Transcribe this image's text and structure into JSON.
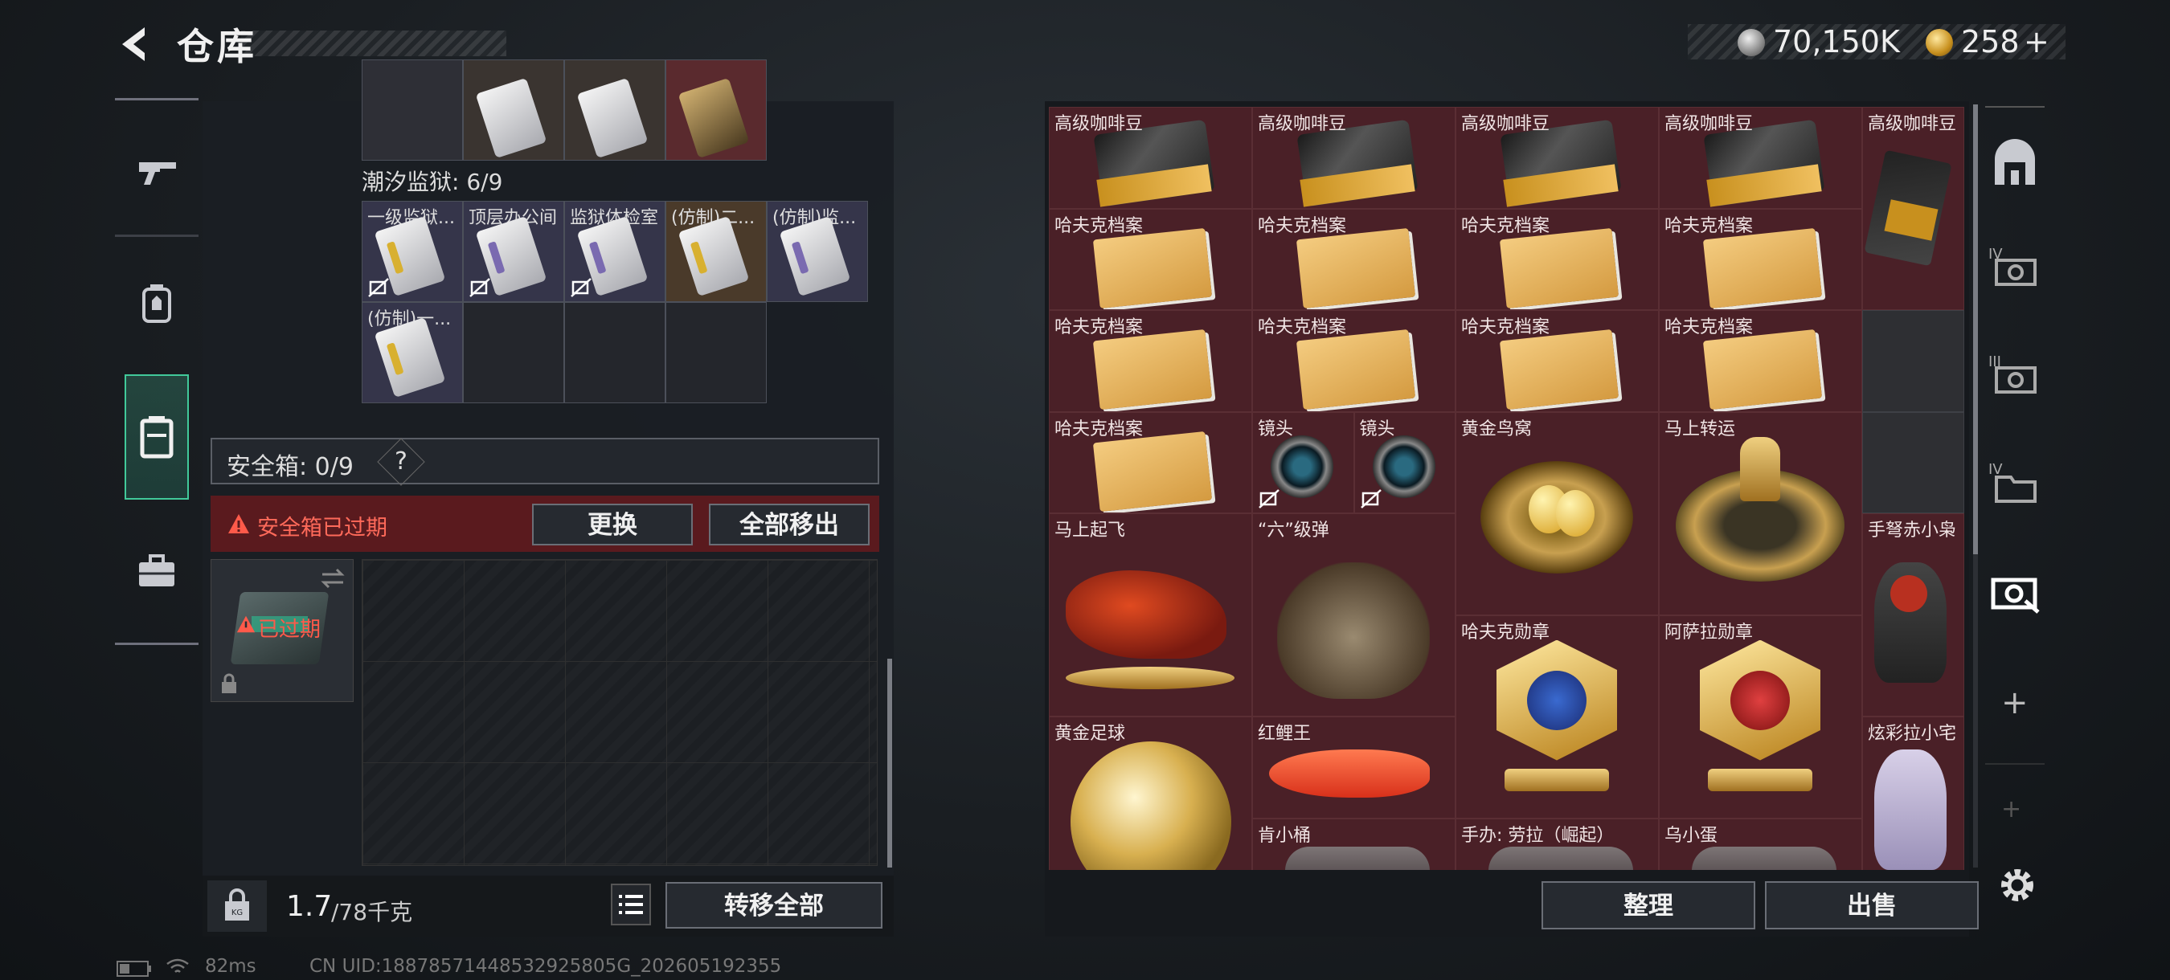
{
  "header": {
    "title": "仓库",
    "silver": "70,150K",
    "gold": "258",
    "gold_plus": "+"
  },
  "left_nav": [
    "gun-icon",
    "backpack-icon",
    "container-icon",
    "briefcase-icon"
  ],
  "prison": {
    "label": "潮汐监狱: 6/9",
    "top_row_colors": [
      "#2e2f36",
      "#3a3430",
      "#3a3430",
      "#5a2a2e"
    ],
    "cells": [
      {
        "label": "一级监狱...",
        "stripe": "#d8b030",
        "bg": "#35354a",
        "nontrade": true
      },
      {
        "label": "顶层办公间",
        "stripe": "#7a6ab0",
        "bg": "#35354a",
        "nontrade": true
      },
      {
        "label": "监狱体检室",
        "stripe": "#7a6ab0",
        "bg": "#35354a",
        "nontrade": true
      },
      {
        "label": "(仿制)二...",
        "stripe": "#d8b030",
        "bg": "#4a3a2a",
        "nontrade": false
      },
      {
        "label": "(仿制)监...",
        "stripe": "#7a6ab0",
        "bg": "#35354a",
        "nontrade": false
      },
      {
        "label": "(仿制)一...",
        "stripe": "#d8b030",
        "bg": "#35354a",
        "nontrade": false
      }
    ]
  },
  "safe_box": {
    "label": "安全箱: 0/9",
    "help": "?",
    "expired_text": "安全箱已过期",
    "replace_btn": "更换",
    "move_all_btn": "全部移出",
    "thumb_status": "已过期"
  },
  "footer_left": {
    "weight": "1.7",
    "weight_max": "/78千克",
    "transfer_btn": "转移全部"
  },
  "footer_right": {
    "sort_btn": "整理",
    "sell_btn": "出售"
  },
  "items": [
    {
      "label": "高级咖啡豆",
      "kind": "coffee"
    },
    {
      "label": "高级咖啡豆",
      "kind": "coffee"
    },
    {
      "label": "高级咖啡豆",
      "kind": "coffee"
    },
    {
      "label": "高级咖啡豆",
      "kind": "coffee"
    },
    {
      "label": "高级咖啡豆",
      "kind": "coffee-bag"
    },
    {
      "label": "哈夫克档案",
      "kind": "folder"
    },
    {
      "label": "哈夫克档案",
      "kind": "folder"
    },
    {
      "label": "哈夫克档案",
      "kind": "folder"
    },
    {
      "label": "哈夫克档案",
      "kind": "folder"
    },
    {
      "label": "哈夫克档案",
      "kind": "folder"
    },
    {
      "label": "哈夫克档案",
      "kind": "folder"
    },
    {
      "label": "哈夫克档案",
      "kind": "folder"
    },
    {
      "label": "哈夫克档案",
      "kind": "folder"
    },
    {
      "label": "哈夫克档案",
      "kind": "folder"
    },
    {
      "label": "镜头",
      "kind": "lens"
    },
    {
      "label": "镜头",
      "kind": "lens"
    },
    {
      "label": "黄金鸟窝",
      "kind": "nest"
    },
    {
      "label": "马上转运",
      "kind": "medal-disc"
    },
    {
      "label": "马上起飞",
      "kind": "horse"
    },
    {
      "label": "“六”级弹",
      "kind": "hand"
    },
    {
      "label": "手弩赤小枭",
      "kind": "figure"
    },
    {
      "label": "哈夫克勋章",
      "kind": "badge-blue"
    },
    {
      "label": "阿萨拉勋章",
      "kind": "badge-red"
    },
    {
      "label": "黄金足球",
      "kind": "ball"
    },
    {
      "label": "红鲤王",
      "kind": "fish"
    },
    {
      "label": "炫彩拉小宅",
      "kind": "figure2"
    },
    {
      "label": "肯小桶",
      "kind": "partial"
    },
    {
      "label": "手办: 劳拉（崛起）",
      "kind": "partial"
    },
    {
      "label": "乌小蛋",
      "kind": "partial"
    }
  ],
  "status": {
    "ping": "82ms",
    "uid": "CN UID:18878571448532925805G_202605192355"
  }
}
